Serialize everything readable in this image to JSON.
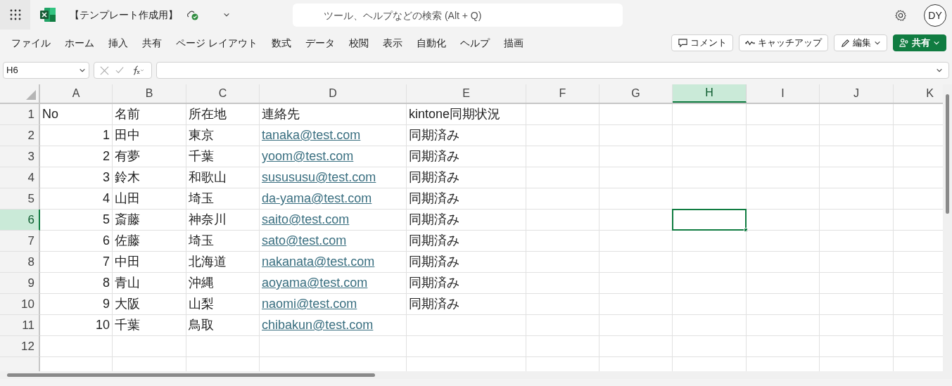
{
  "title_bar": {
    "file_name": "【テンプレート作成用】",
    "search_placeholder": "ツール、ヘルプなどの検索 (Alt + Q)",
    "avatar": "DY"
  },
  "menu": [
    "ファイル",
    "ホーム",
    "挿入",
    "共有",
    "ページ レイアウト",
    "数式",
    "データ",
    "校閲",
    "表示",
    "自動化",
    "ヘルプ",
    "描画"
  ],
  "actions": [
    {
      "kind": "comment",
      "label": "コメント"
    },
    {
      "kind": "catchup",
      "label": "キャッチアップ"
    },
    {
      "kind": "edit",
      "label": "編集"
    },
    {
      "kind": "share",
      "label": "共有"
    }
  ],
  "formula_bar": {
    "name_box": "H6"
  },
  "sheet": {
    "columns": [
      {
        "label": "A",
        "selected": false
      },
      {
        "label": "B",
        "selected": false
      },
      {
        "label": "C",
        "selected": false
      },
      {
        "label": "D",
        "selected": false
      },
      {
        "label": "E",
        "selected": false
      },
      {
        "label": "F",
        "selected": false
      },
      {
        "label": "G",
        "selected": false
      },
      {
        "label": "H",
        "selected": true
      },
      {
        "label": "I",
        "selected": false
      },
      {
        "label": "J",
        "selected": false
      },
      {
        "label": "K",
        "selected": false
      }
    ],
    "rows": [
      {
        "number": "1",
        "selected": false,
        "cells": [
          {
            "text": "No",
            "kind": "text"
          },
          {
            "text": "名前",
            "kind": "text"
          },
          {
            "text": "所在地",
            "kind": "text"
          },
          {
            "text": "連絡先",
            "kind": "text"
          },
          {
            "text": "kintone同期状況",
            "kind": "text"
          }
        ]
      },
      {
        "number": "2",
        "selected": false,
        "cells": [
          {
            "text": "1",
            "kind": "number"
          },
          {
            "text": "田中",
            "kind": "text"
          },
          {
            "text": "東京",
            "kind": "text"
          },
          {
            "text": "tanaka@test.com",
            "kind": "link"
          },
          {
            "text": "同期済み",
            "kind": "text"
          }
        ]
      },
      {
        "number": "3",
        "selected": false,
        "cells": [
          {
            "text": "2",
            "kind": "number"
          },
          {
            "text": "有夢",
            "kind": "text"
          },
          {
            "text": "千葉",
            "kind": "text"
          },
          {
            "text": "yoom@test.com",
            "kind": "link"
          },
          {
            "text": "同期済み",
            "kind": "text"
          }
        ]
      },
      {
        "number": "4",
        "selected": false,
        "cells": [
          {
            "text": "3",
            "kind": "number"
          },
          {
            "text": "鈴木",
            "kind": "text"
          },
          {
            "text": "和歌山",
            "kind": "text"
          },
          {
            "text": "susususu@test.com",
            "kind": "link"
          },
          {
            "text": "同期済み",
            "kind": "text"
          }
        ]
      },
      {
        "number": "5",
        "selected": false,
        "cells": [
          {
            "text": "4",
            "kind": "number"
          },
          {
            "text": "山田",
            "kind": "text"
          },
          {
            "text": "埼玉",
            "kind": "text"
          },
          {
            "text": "da-yama@test.com",
            "kind": "link"
          },
          {
            "text": "同期済み",
            "kind": "text"
          }
        ]
      },
      {
        "number": "6",
        "selected": true,
        "cells": [
          {
            "text": "5",
            "kind": "number"
          },
          {
            "text": "斎藤",
            "kind": "text"
          },
          {
            "text": "神奈川",
            "kind": "text"
          },
          {
            "text": "saito@test.com",
            "kind": "link"
          },
          {
            "text": "同期済み",
            "kind": "text"
          }
        ]
      },
      {
        "number": "7",
        "selected": false,
        "cells": [
          {
            "text": "6",
            "kind": "number"
          },
          {
            "text": "佐藤",
            "kind": "text"
          },
          {
            "text": "埼玉",
            "kind": "text"
          },
          {
            "text": "sato@test.com",
            "kind": "link"
          },
          {
            "text": "同期済み",
            "kind": "text"
          }
        ]
      },
      {
        "number": "8",
        "selected": false,
        "cells": [
          {
            "text": "7",
            "kind": "number"
          },
          {
            "text": "中田",
            "kind": "text"
          },
          {
            "text": "北海道",
            "kind": "text"
          },
          {
            "text": "nakanata@test.com",
            "kind": "link"
          },
          {
            "text": "同期済み",
            "kind": "text"
          }
        ]
      },
      {
        "number": "9",
        "selected": false,
        "cells": [
          {
            "text": "8",
            "kind": "number"
          },
          {
            "text": "青山",
            "kind": "text"
          },
          {
            "text": "沖縄",
            "kind": "text"
          },
          {
            "text": "aoyama@test.com",
            "kind": "link"
          },
          {
            "text": "同期済み",
            "kind": "text"
          }
        ]
      },
      {
        "number": "10",
        "selected": false,
        "cells": [
          {
            "text": "9",
            "kind": "number"
          },
          {
            "text": "大阪",
            "kind": "text"
          },
          {
            "text": "山梨",
            "kind": "text"
          },
          {
            "text": "naomi@test.com",
            "kind": "link"
          },
          {
            "text": "同期済み",
            "kind": "text"
          }
        ]
      },
      {
        "number": "11",
        "selected": false,
        "cells": [
          {
            "text": "10",
            "kind": "number"
          },
          {
            "text": "千葉",
            "kind": "text"
          },
          {
            "text": "鳥取",
            "kind": "text"
          },
          {
            "text": "chibakun@test.com",
            "kind": "link"
          }
        ]
      },
      {
        "number": "12",
        "selected": false,
        "cells": []
      }
    ]
  }
}
